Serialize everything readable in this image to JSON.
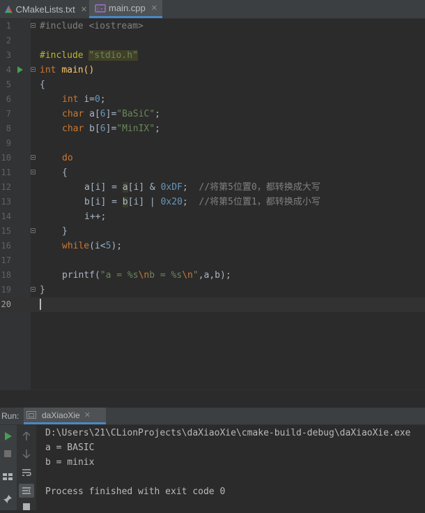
{
  "tabs": [
    {
      "label": "CMakeLists.txt",
      "active": false
    },
    {
      "label": "main.cpp",
      "active": true
    }
  ],
  "editor": {
    "current_line": 20,
    "line_numbers": [
      "1",
      "2",
      "3",
      "4",
      "5",
      "6",
      "7",
      "8",
      "9",
      "10",
      "11",
      "12",
      "13",
      "14",
      "15",
      "16",
      "17",
      "18",
      "19",
      "20"
    ],
    "code": {
      "l1": "#include <iostream>",
      "l3_pp": "#include ",
      "l3_str": "\"stdio.h\"",
      "l4_kw": "int ",
      "l4_rest": "main()",
      "l5": "{",
      "l6_kw": "int ",
      "l6_a": "i=",
      "l6_num": "0",
      "l6_b": ";",
      "l7_kw": "char ",
      "l7_a": "a[",
      "l7_num": "6",
      "l7_b": "]=",
      "l7_str": "\"BaSiC\"",
      "l7_c": ";",
      "l8_kw": "char ",
      "l8_a": "b[",
      "l8_num": "6",
      "l8_b": "]=",
      "l8_str": "\"MinIX\"",
      "l8_c": ";",
      "l10_kw": "do",
      "l11": "{",
      "l12_a": "a[i] = ",
      "l12_hl": "a",
      "l12_b": "[i] & ",
      "l12_num": "0xDF",
      "l12_c": ";  ",
      "l12_cmt": "//将第5位置0，都转换成大写",
      "l13_a": "b[i] = ",
      "l13_hl": "b",
      "l13_b": "[i] | ",
      "l13_num": "0x20",
      "l13_c": ";  ",
      "l13_cmt": "//将第5位置1，都转换成小写",
      "l14": "i++;",
      "l15": "}",
      "l16_kw": "while",
      "l16_a": "(i<",
      "l16_num": "5",
      "l16_b": ");",
      "l18_a": "printf(",
      "l18_s1": "\"a = %s",
      "l18_e1": "\\n",
      "l18_s2": "b = %s",
      "l18_e2": "\\n",
      "l18_s3": "\"",
      "l18_b": ",a,b);",
      "l19": "}"
    }
  },
  "run_panel": {
    "label": "Run:",
    "tab_label": "daXiaoXie",
    "output": [
      "D:\\Users\\21\\CLionProjects\\daXiaoXie\\cmake-build-debug\\daXiaoXie.exe",
      "a = BASIC",
      "b = minix",
      "",
      "Process finished with exit code 0"
    ]
  },
  "colors": {
    "keyword": "#cc7832",
    "number": "#6897bb",
    "string": "#6a8759",
    "comment": "#808080",
    "preprocessor": "#bbb529",
    "run_green": "#499c54",
    "tab_accent": "#4a88c7"
  },
  "icons": [
    "cmake-file-icon",
    "cpp-file-icon",
    "close-icon",
    "fold-marker-icon",
    "run-gutter-icon",
    "run-config-icon",
    "rerun-icon",
    "stop-icon",
    "layout-icon",
    "pin-icon",
    "arrow-up-icon",
    "arrow-down-icon",
    "soft-wrap-icon",
    "scroll-to-end-icon",
    "print-icon"
  ]
}
